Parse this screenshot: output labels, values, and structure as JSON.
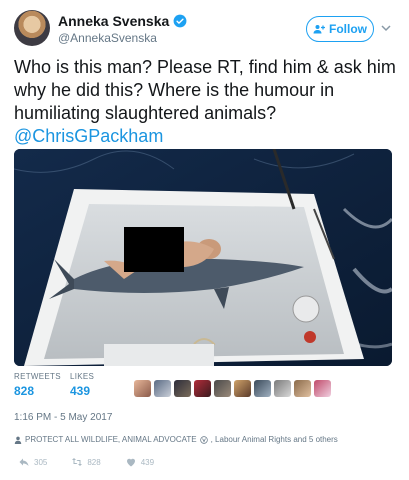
{
  "author": {
    "display_name": "Anneka Svenska",
    "handle": "@AnnekaSvenska"
  },
  "follow_button": {
    "label": "Follow"
  },
  "tweet": {
    "text": "Who is this man? Please RT, find him & ask him why he did this? Where is the humour in humiliating slaughtered animals?",
    "mention": "@ChrisGPackham"
  },
  "stats": {
    "retweets_label": "RETWEETS",
    "retweets_value": "828",
    "likes_label": "LIKES",
    "likes_value": "439"
  },
  "timestamp": "1:16 PM - 5 May 2017",
  "context": {
    "text": "PROTECT ALL WILDLIFE, ANIMAL ADVOCATE",
    "suffix": ", Labour Animal Rights and 5 others"
  },
  "actions": {
    "reply_count": "305",
    "retweet_count": "828",
    "like_count": "439"
  },
  "colors": {
    "accent": "#1da1f2",
    "link": "#1b95e0",
    "muted": "#657786"
  }
}
